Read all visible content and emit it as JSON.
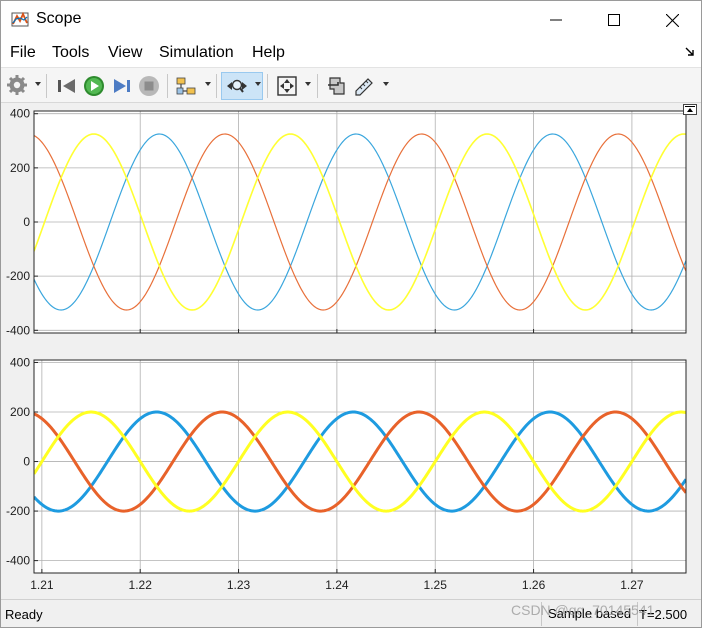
{
  "window": {
    "title": "Scope",
    "icon": "matlab-scope-icon",
    "controls": [
      "minimize-icon",
      "maximize-icon",
      "close-icon"
    ]
  },
  "menu": {
    "items": [
      "File",
      "Tools",
      "View",
      "Simulation",
      "Help"
    ],
    "pin_icon": "dock-arrow-icon"
  },
  "toolbar": {
    "icons": [
      "settings-gear-icon",
      "step-back-icon",
      "run-icon",
      "step-forward-icon",
      "stop-icon",
      "signal-selector-icon",
      "zoom-icon",
      "autoscale-icon",
      "highlight-block-icon",
      "measurement-icon"
    ]
  },
  "colors": {
    "series_a": "#4DBEEE",
    "series_b": "#D95319",
    "series_c": "#EDB120",
    "series_c_display": "#ffff33",
    "plot_bg": "#ffffff",
    "grid": "#b0b0b0"
  },
  "chart_data": [
    {
      "type": "line",
      "title": "",
      "xlabel": "",
      "ylabel": "",
      "xlim": [
        1.2092,
        1.2755
      ],
      "ylim": [
        -410,
        410
      ],
      "yticks": [
        "400",
        "200",
        "0",
        "-200",
        "-400"
      ],
      "ytick_values": [
        400,
        200,
        0,
        -200,
        -400
      ],
      "xticks": [
        1.22,
        1.23,
        1.24,
        1.25,
        1.26,
        1.27
      ],
      "grid": true,
      "series": [
        {
          "color": "#3aa6dd",
          "amplitude": 325,
          "frequency_hz": 50,
          "phase_deg": 55,
          "width": 1.2
        },
        {
          "color": "#e8703a",
          "amplitude": 325,
          "frequency_hz": 50,
          "phase_deg": -65,
          "width": 1.2
        },
        {
          "color": "#ffff33",
          "amplitude": 325,
          "frequency_hz": 50,
          "phase_deg": 175,
          "width": 1.6
        }
      ]
    },
    {
      "type": "line",
      "title": "",
      "xlabel": "",
      "ylabel": "",
      "xlim": [
        1.2092,
        1.2755
      ],
      "ylim": [
        -450,
        410
      ],
      "yticks": [
        "400",
        "200",
        "0",
        "-200",
        "-400"
      ],
      "ytick_values": [
        400,
        200,
        0,
        -200,
        -400
      ],
      "xticks": [
        "1.21",
        "1.22",
        "1.23",
        "1.24",
        "1.25",
        "1.26",
        "1.27"
      ],
      "xtick_values": [
        1.21,
        1.22,
        1.23,
        1.24,
        1.25,
        1.26,
        1.27
      ],
      "grid": true,
      "series": [
        {
          "color": "#1e9be0",
          "amplitude": 200,
          "frequency_hz": 50,
          "phase_deg": 60,
          "width": 3
        },
        {
          "color": "#e8622a",
          "amplitude": 200,
          "frequency_hz": 50,
          "phase_deg": -60,
          "width": 3
        },
        {
          "color": "#ffff22",
          "amplitude": 200,
          "frequency_hz": 50,
          "phase_deg": 180,
          "width": 3
        }
      ]
    }
  ],
  "status": {
    "ready": "Ready",
    "sample_mode": "Sample based",
    "time": "T=2.500"
  },
  "watermark": "CSDN @qq_70145541"
}
